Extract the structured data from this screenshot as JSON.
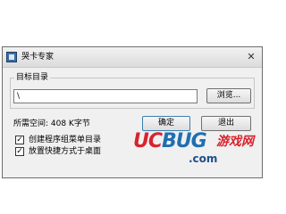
{
  "window": {
    "title": "哭卡专家",
    "close_glyph": "✕"
  },
  "target_group": {
    "label": "目标目录",
    "path_value": "\\",
    "browse_label": "浏览..."
  },
  "space_required": "所需空间: 408 K字节",
  "buttons": {
    "ok_label": "确定",
    "cancel_label": "退出"
  },
  "options": [
    {
      "label": "创建程序组菜单目录",
      "checked": true
    },
    {
      "label": "放置快捷方式于桌面",
      "checked": true
    }
  ],
  "check_glyph": "✓",
  "watermark": {
    "logo_uc": "UC",
    "logo_bug": "BUG",
    "logo_cn": "游戏网",
    "domain": ".com"
  },
  "colors": {
    "accent_red": "#d9232d",
    "accent_blue": "#1f6fb2"
  }
}
